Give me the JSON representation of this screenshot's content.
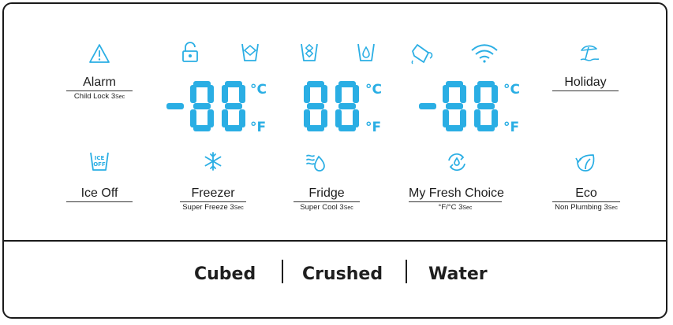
{
  "colors": {
    "display_blue": "#2aaee4",
    "text": "#1d1d1d",
    "frame": "#1a1a1a"
  },
  "buttons": {
    "alarm": {
      "label": "Alarm",
      "sub": "Child Lock 3",
      "sub_small": "Sec"
    },
    "ice_off": {
      "label": "Ice Off"
    },
    "freezer": {
      "label": "Freezer",
      "sub": "Super Freeze 3",
      "sub_small": "Sec"
    },
    "fridge": {
      "label": "Fridge",
      "sub": "Super Cool 3",
      "sub_small": "Sec"
    },
    "my_fresh_choice": {
      "label": "My Fresh Choice",
      "sub": "°F/°C 3",
      "sub_small": "Sec"
    },
    "holiday": {
      "label": "Holiday"
    },
    "eco": {
      "label": "Eco",
      "sub": "Non Plumbing 3",
      "sub_small": "Sec"
    }
  },
  "displays": {
    "freezer_temp": {
      "value": "-88",
      "unit_c": "°C",
      "unit_f": "°F"
    },
    "fridge_temp": {
      "value": "88",
      "unit_c": "°C",
      "unit_f": "°F"
    },
    "fresh_temp": {
      "value": "-88",
      "unit_c": "°C",
      "unit_f": "°F"
    }
  },
  "ice_off_icon_text": "ICE OFF",
  "dispenser": {
    "cubed": "Cubed",
    "crushed": "Crushed",
    "water": "Water"
  },
  "icons": [
    "warning-icon",
    "lock-icon",
    "water-cup-icon",
    "ice-cup-icon",
    "water-drop-cup-icon",
    "pitcher-icon",
    "wifi-icon",
    "beach-umbrella-icon",
    "ice-off-icon",
    "snowflake-icon",
    "cool-air-icon",
    "fresh-choice-icon",
    "eco-leaf-icon"
  ]
}
